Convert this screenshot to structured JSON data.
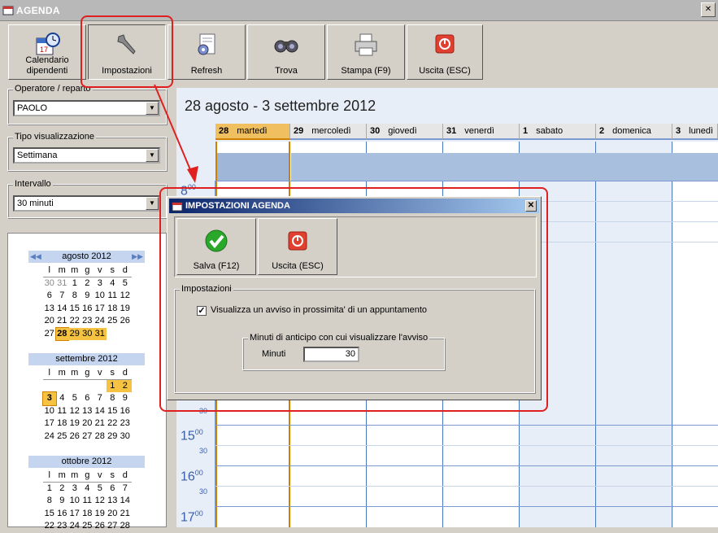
{
  "window": {
    "title": "AGENDA"
  },
  "toolbar": [
    {
      "label": "Calendario\ndipendenti",
      "icon": "calendar-clock-icon"
    },
    {
      "label": "Impostazioni",
      "icon": "wrench-icon"
    },
    {
      "label": "Refresh",
      "icon": "refresh-gear-icon"
    },
    {
      "label": "Trova",
      "icon": "binoculars-icon"
    },
    {
      "label": "Stampa (F9)",
      "icon": "printer-icon"
    },
    {
      "label": "Uscita (ESC)",
      "icon": "power-icon"
    }
  ],
  "left": {
    "operatore_label": "Operatore / reparto",
    "operatore_value": "PAOLO",
    "tipo_label": "Tipo visualizzazione",
    "tipo_value": "Settimana",
    "intervallo_label": "Intervallo",
    "intervallo_value": "30 minuti"
  },
  "minical": {
    "weekdays": [
      "l",
      "m",
      "m",
      "g",
      "v",
      "s",
      "d"
    ],
    "months": [
      {
        "title": "agosto 2012",
        "days": [
          "30",
          "31",
          "1",
          "2",
          "3",
          "4",
          "5",
          "6",
          "7",
          "8",
          "9",
          "10",
          "11",
          "12",
          "13",
          "14",
          "15",
          "16",
          "17",
          "18",
          "19",
          "20",
          "21",
          "22",
          "23",
          "24",
          "25",
          "26",
          "27",
          "28",
          "29",
          "30",
          "31"
        ]
      },
      {
        "title": "settembre 2012",
        "days": [
          "1",
          "2",
          "3",
          "4",
          "5",
          "6",
          "7",
          "8",
          "9",
          "10",
          "11",
          "12",
          "13",
          "14",
          "15",
          "16",
          "17",
          "18",
          "19",
          "20",
          "21",
          "22",
          "23",
          "24",
          "25",
          "26",
          "27",
          "28",
          "29",
          "30"
        ]
      },
      {
        "title": "ottobre 2012",
        "days": [
          "1",
          "2",
          "3",
          "4",
          "5",
          "6",
          "7",
          "8",
          "9",
          "10",
          "11",
          "12",
          "13",
          "14",
          "15",
          "16",
          "17",
          "18",
          "19",
          "20",
          "21",
          "22",
          "23",
          "24",
          "25",
          "26",
          "27",
          "28"
        ]
      }
    ]
  },
  "calendar": {
    "range_title": "28 agosto - 3 settembre 2012",
    "days": [
      {
        "num": "28",
        "name": "martedì"
      },
      {
        "num": "29",
        "name": "mercoledì"
      },
      {
        "num": "30",
        "name": "giovedì"
      },
      {
        "num": "31",
        "name": "venerdì"
      },
      {
        "num": "1",
        "name": "sabato"
      },
      {
        "num": "2",
        "name": "domenica"
      },
      {
        "num": "3",
        "name": "lunedì"
      }
    ],
    "times": [
      {
        "h": "8",
        "m": "00"
      },
      {
        "h": "15",
        "m": "00"
      },
      {
        "h": "16",
        "m": "00"
      },
      {
        "h": "17",
        "m": "00"
      }
    ],
    "half": "30"
  },
  "dialog": {
    "title": "IMPOSTAZIONI AGENDA",
    "close": "✕",
    "save_label": "Salva (F12)",
    "exit_label": "Uscita (ESC)",
    "group_label": "Impostazioni",
    "checkbox_label": "Visualizza un avviso in prossimita' di un appuntamento",
    "checkbox_checked": true,
    "check_mark": "✓",
    "subgroup_label": "Minuti di anticipo con cui visualizzare l'avviso",
    "minuti_label": "Minuti",
    "minuti_value": "30"
  },
  "colors": {
    "accent": "#0a246a",
    "highlight": "#f5c242",
    "annotation": "#e02020"
  }
}
